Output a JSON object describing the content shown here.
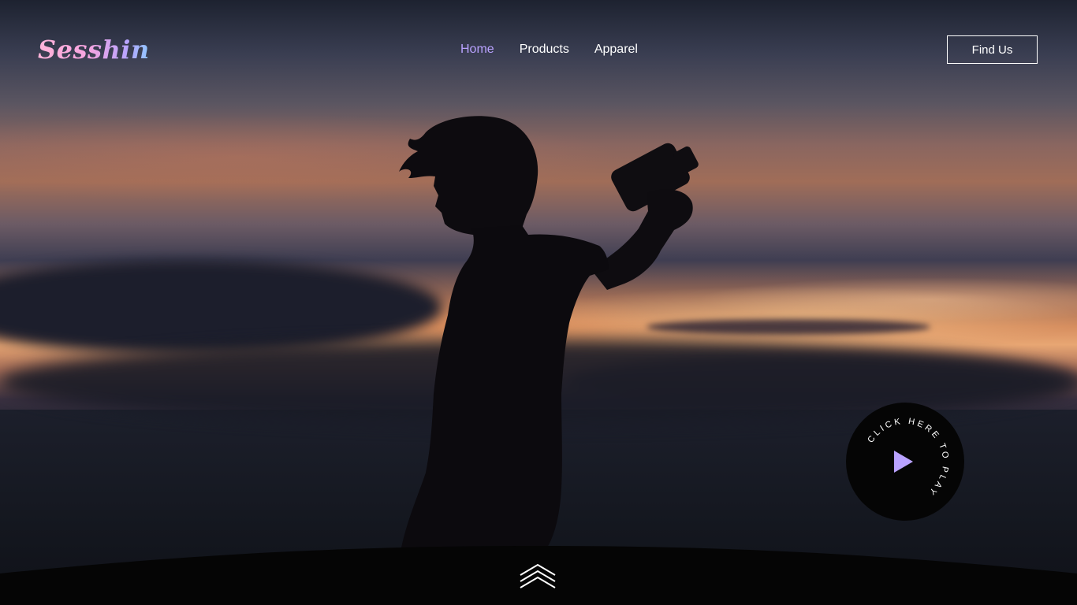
{
  "header": {
    "logo_text": "Sesshin",
    "nav": [
      {
        "label": "Home",
        "active": true
      },
      {
        "label": "Products",
        "active": false
      },
      {
        "label": "Apparel",
        "active": false
      }
    ],
    "cta_label": "Find Us"
  },
  "hero": {
    "play_badge_text": "CLICK HERE TO PLAY",
    "play_icon": "play-icon",
    "scroll_icon": "double-chevron-up-icon"
  },
  "colors": {
    "accent": "#b9a2ff",
    "play_triangle": "#b9a2ff",
    "badge_bg": "#050505",
    "text": "#ffffff"
  }
}
